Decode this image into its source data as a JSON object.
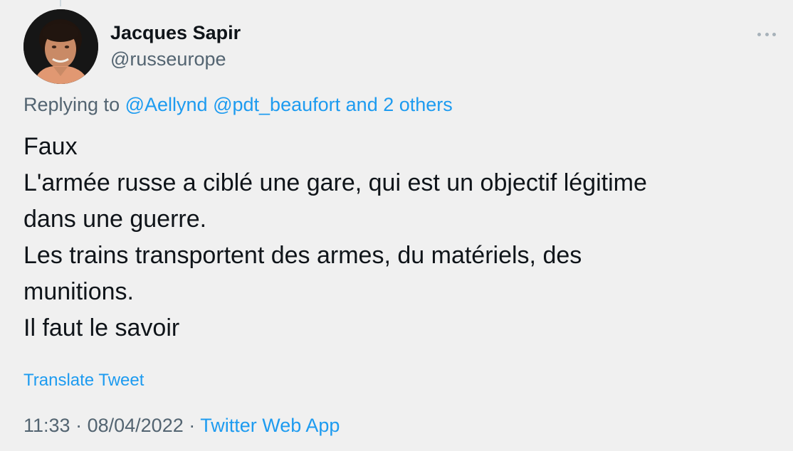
{
  "author": {
    "name": "Jacques Sapir",
    "handle": "@russeurope"
  },
  "icons": {
    "more": "more-horizontal-icon",
    "avatar": "profile-photo"
  },
  "reply": {
    "prefix": "Replying to",
    "mention_1": "@Aellynd",
    "mention_2": "@pdt_beaufort",
    "others": "and 2 others"
  },
  "tweet": {
    "lines": [
      "Faux",
      "L'armée russe a ciblé une gare, qui est un objectif légitime",
      "dans une guerre.",
      "Les trains transportent des armes, du matériels, des",
      "munitions.",
      "Il faut le savoir"
    ]
  },
  "translate_label": "Translate Tweet",
  "meta": {
    "time": "11:33",
    "separator": "·",
    "date": "08/04/2022",
    "source": "Twitter Web App"
  },
  "colors": {
    "background": "#f0f0f0",
    "link": "#1d9bf0",
    "secondary_text": "#536471",
    "primary_text": "#0f1419"
  }
}
